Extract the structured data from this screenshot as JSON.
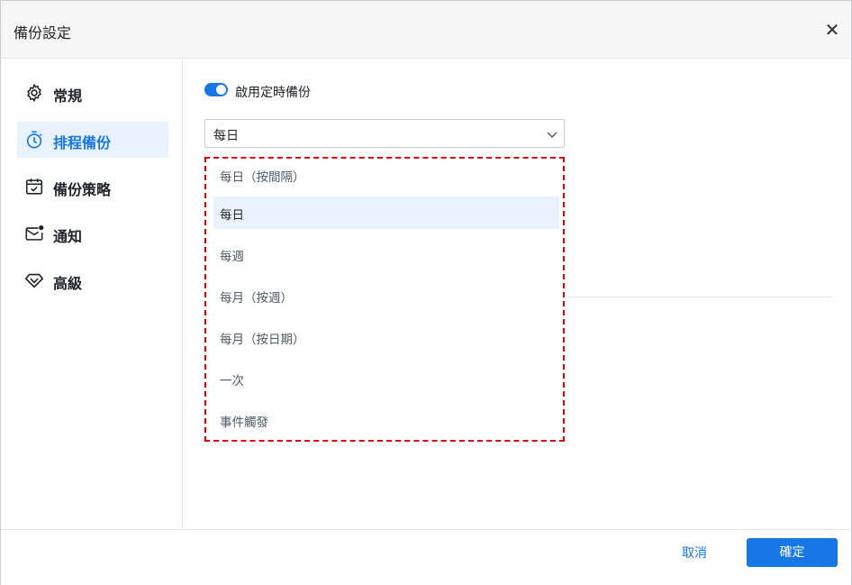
{
  "dialog": {
    "title": "備份設定"
  },
  "sidebar": {
    "items": [
      {
        "label": "常規",
        "icon": "gear-icon"
      },
      {
        "label": "排程備份",
        "icon": "stopwatch-icon"
      },
      {
        "label": "備份策略",
        "icon": "calendar-check-icon"
      },
      {
        "label": "通知",
        "icon": "mail-icon"
      },
      {
        "label": "高級",
        "icon": "diamond-icon"
      }
    ],
    "active_index": 1
  },
  "schedule": {
    "enabled": true,
    "enable_label": "啟用定時備份",
    "selected": "每日",
    "options": [
      "每日（按間隔）",
      "每日",
      "每週",
      "每月（按週）",
      "每月（按日期）",
      "一次",
      "事件觸發"
    ],
    "selected_index": 1
  },
  "footer": {
    "cancel_label": "取消",
    "ok_label": "確定"
  },
  "colors": {
    "accent": "#1677e5",
    "highlight": "#e8f3ff",
    "annotation": "#e00000"
  }
}
